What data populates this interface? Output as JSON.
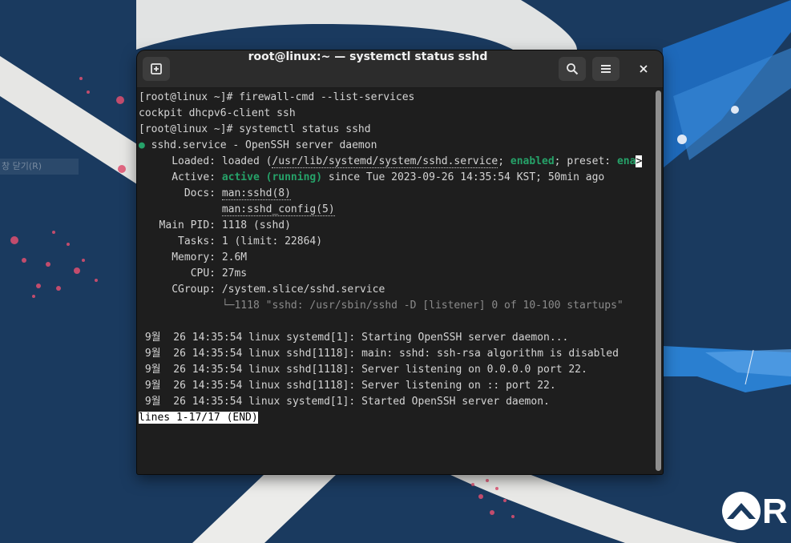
{
  "desktop": {
    "hidden_label": "창 닫기(R)",
    "logo_text": "R",
    "colors": {
      "background": "#1a3a5f",
      "swoosh": "#ececea",
      "accent_blue": "#1f6fc4",
      "splatter": "#e05070"
    }
  },
  "window": {
    "title": "root@linux:~ — systemctl status sshd",
    "buttons": [
      "new-tab",
      "search",
      "menu",
      "close"
    ]
  },
  "terminal": {
    "l1": "[root@linux ~]# firewall-cmd --list-services",
    "l2": "cockpit dhcpv6-client ssh",
    "l3": "[root@linux ~]# systemctl status sshd",
    "l4_dot": "●",
    "l4_text": "sshd.service - OpenSSH server daemon",
    "loaded_label": "Loaded:",
    "loaded_pre": "loaded (",
    "loaded_path": "/usr/lib/systemd/system/sshd.service",
    "loaded_sep": "; ",
    "loaded_enabled": "enabled",
    "loaded_preset_label": "; preset: ",
    "loaded_preset_value": "ena",
    "loaded_trunc": ">",
    "active_label": "Active:",
    "active_state": "active (running)",
    "active_rest": " since Tue 2023-09-26 14:35:54 KST; 50min ago",
    "docs_label": "Docs:",
    "docs_1": "man:sshd(8)",
    "docs_2": "man:sshd_config(5)",
    "pid_label": "Main PID:",
    "pid_value": "1118 (sshd)",
    "tasks_label": "Tasks:",
    "tasks_value": "1 (limit: 22864)",
    "memory_label": "Memory:",
    "memory_value": "2.6M",
    "cpu_label": "CPU:",
    "cpu_value": "27ms",
    "cgroup_label": "CGroup:",
    "cgroup_value": "/system.slice/sshd.service",
    "cgroup_tree": "└─",
    "cgroup_proc": "1118 \"sshd: /usr/sbin/sshd -D [listener] 0 of 10-100 startups\"",
    "log": [
      " 9월  26 14:35:54 linux systemd[1]: Starting OpenSSH server daemon...",
      " 9월  26 14:35:54 linux sshd[1118]: main: sshd: ssh-rsa algorithm is disabled",
      " 9월  26 14:35:54 linux sshd[1118]: Server listening on 0.0.0.0 port 22.",
      " 9월  26 14:35:54 linux sshd[1118]: Server listening on :: port 22.",
      " 9월  26 14:35:54 linux systemd[1]: Started OpenSSH server daemon."
    ],
    "pager_status": "lines 1-17/17 (END)"
  }
}
